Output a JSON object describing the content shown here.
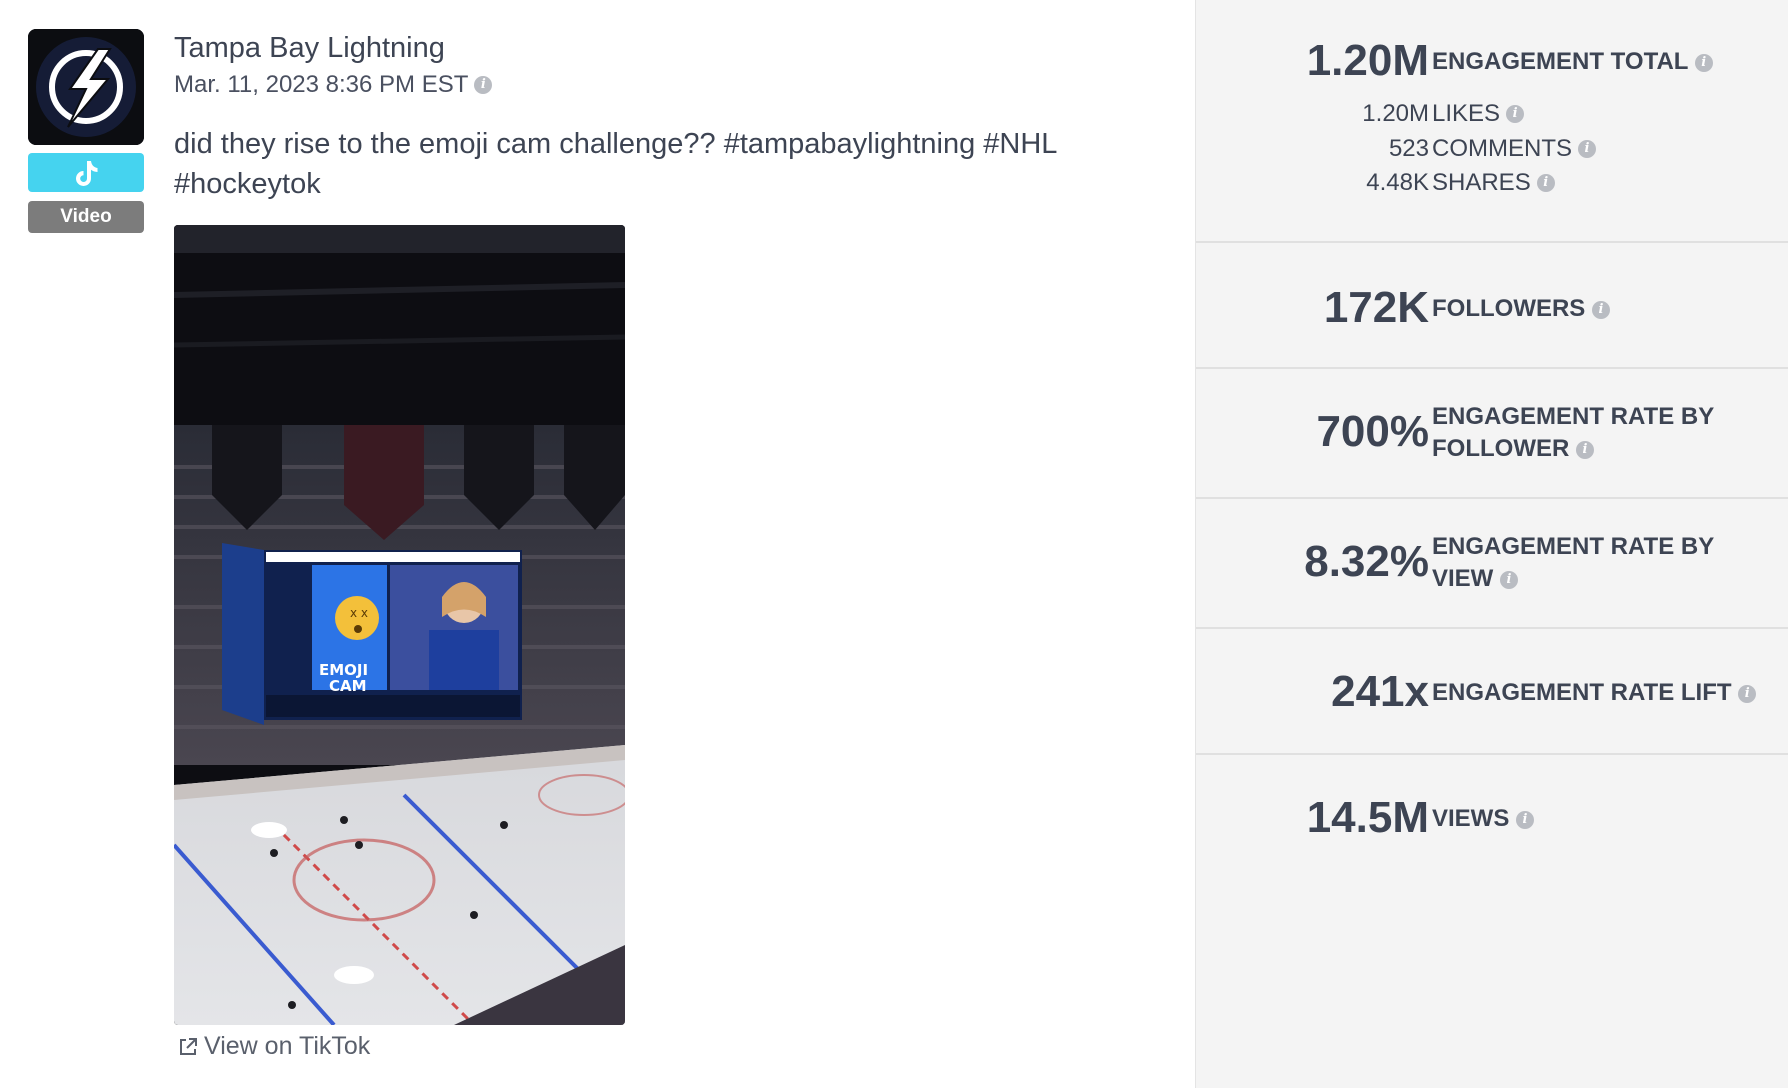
{
  "post": {
    "author": "Tampa Bay Lightning",
    "date": "Mar. 11, 2023 8:36 PM EST",
    "caption": "did they rise to the emoji cam challenge?? #tampabaylightning #NHL #hockeytok",
    "platform_icon": "tiktok-icon",
    "type_badge": "Video",
    "view_link": "View on TikTok"
  },
  "stats": {
    "engagement_total": {
      "value": "1.20M",
      "label": "ENGAGEMENT TOTAL"
    },
    "likes": {
      "value": "1.20M",
      "label": "LIKES"
    },
    "comments": {
      "value": "523",
      "label": "COMMENTS"
    },
    "shares": {
      "value": "4.48K",
      "label": "SHARES"
    },
    "followers": {
      "value": "172K",
      "label": "FOLLOWERS"
    },
    "engagement_rate_follower": {
      "value": "700%",
      "label": "ENGAGEMENT RATE BY FOLLOWER"
    },
    "engagement_rate_view": {
      "value": "8.32%",
      "label": "ENGAGEMENT RATE BY VIEW"
    },
    "engagement_rate_lift": {
      "value": "241x",
      "label": "ENGAGEMENT RATE LIFT"
    },
    "views": {
      "value": "14.5M",
      "label": "VIEWS"
    }
  },
  "colors": {
    "tiktok_badge": "#45d3ef",
    "video_badge": "#7c7c7c",
    "panel_bg": "#f4f4f4",
    "text": "#3d4453"
  }
}
